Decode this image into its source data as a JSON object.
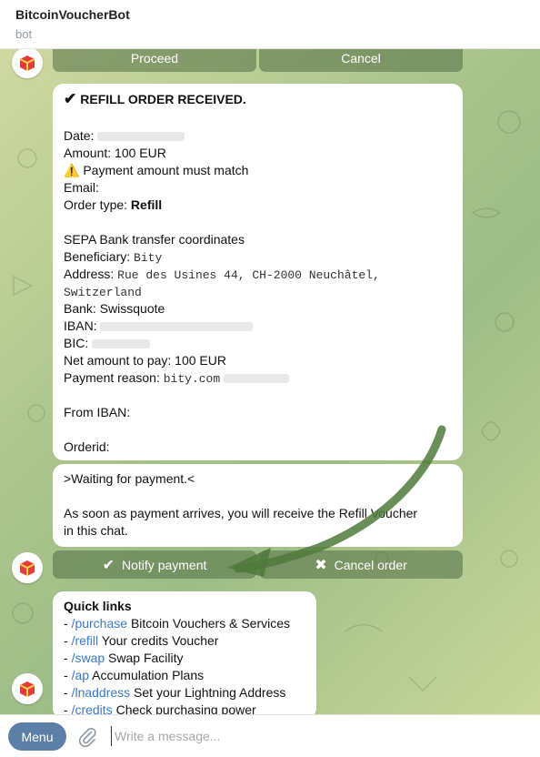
{
  "header": {
    "title": "BitcoinVoucherBot",
    "subtitle": "bot"
  },
  "keyboard_top": {
    "proceed": "Proceed",
    "cancel": "Cancel"
  },
  "order": {
    "heading": "REFILL ORDER RECEIVED.",
    "date_label": "Date:",
    "amount": "Amount: 100 EUR",
    "warning": "Payment amount must match",
    "email_label": "Email:",
    "order_type_label": "Order type:",
    "order_type_value": "Refill",
    "sepa_heading": "SEPA Bank transfer coordinates",
    "beneficiary_label": "Beneficiary:",
    "beneficiary_value": "Bity",
    "address_label": "Address:",
    "address_value_1": "Rue des Usines 44, CH-2000 Neuchâtel,",
    "address_value_2": "Switzerland",
    "bank": "Bank: Swissquote",
    "iban_label": "IBAN:",
    "bic_label": "BIC:",
    "net_amount": "Net amount to pay: 100 EUR",
    "reason_label": "Payment reason:",
    "reason_value": "bity.com",
    "from_iban_label": "From IBAN:",
    "orderid_label": "Orderid:"
  },
  "waiting": {
    "line1": ">Waiting for payment.<",
    "line2": "As soon as payment arrives, you will receive the Refill Voucher",
    "line3": "in this chat."
  },
  "keyboard_bottom": {
    "notify": "Notify payment",
    "cancel_order": "Cancel order"
  },
  "quick_links": {
    "heading": "Quick links",
    "items": [
      {
        "cmd": "/purchase",
        "text": "Bitcoin Vouchers & Services"
      },
      {
        "cmd": "/refill",
        "text": "Your credits Voucher"
      },
      {
        "cmd": "/swap",
        "text": "Swap Facility"
      },
      {
        "cmd": "/ap",
        "text": "Accumulation Plans"
      },
      {
        "cmd": "/lnaddress",
        "text": "Set your Lightning Address"
      },
      {
        "cmd": "/credits",
        "text": "Check purchasing power"
      }
    ]
  },
  "input": {
    "menu_label": "Menu",
    "placeholder": "Write a message..."
  },
  "icons": {
    "check": "check-icon",
    "warning": "warning-icon",
    "cross": "cross-icon",
    "attach": "paperclip-icon"
  },
  "colors": {
    "link": "#3a79c4",
    "menu_button": "#5b7fa6",
    "arrow": "#4f7a3a"
  }
}
